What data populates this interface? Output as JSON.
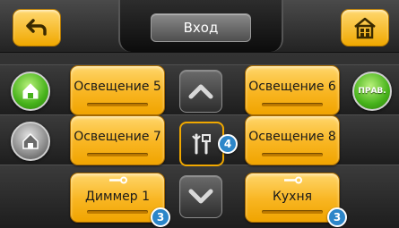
{
  "header": {
    "title": "Вход"
  },
  "controls": {
    "back_icon": "back-arrow-icon",
    "home_icon": "home-icon",
    "right_round_label": "ПРАВ."
  },
  "tiles": {
    "light5": "Освещение 5",
    "light6": "Освещение 6",
    "light7": "Освещение 7",
    "light8": "Освещение 8",
    "dimmer1": "Диммер 1",
    "kitchen": "Кухня"
  },
  "badges": {
    "tools": "4",
    "dimmer1": "3",
    "kitchen": "3"
  },
  "colors": {
    "tile": "#f8b521",
    "accent_green": "#46b21a",
    "badge": "#2c86c9"
  }
}
